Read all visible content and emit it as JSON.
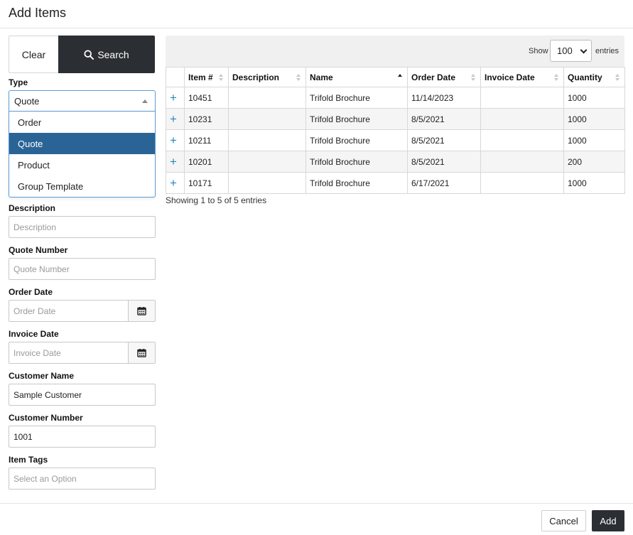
{
  "modal": {
    "title": "Add Items"
  },
  "search_panel": {
    "clear_label": "Clear",
    "search_label": "Search",
    "type": {
      "label": "Type",
      "value": "Quote",
      "options": [
        "Order",
        "Quote",
        "Product",
        "Group Template"
      ],
      "selected_index": 1
    },
    "description": {
      "label": "Description",
      "placeholder": "Description",
      "value": ""
    },
    "quote_number": {
      "label": "Quote Number",
      "placeholder": "Quote Number",
      "value": ""
    },
    "order_date": {
      "label": "Order Date",
      "placeholder": "Order Date"
    },
    "invoice_date": {
      "label": "Invoice Date",
      "placeholder": "Invoice Date"
    },
    "customer_name": {
      "label": "Customer Name",
      "value": "Sample Customer"
    },
    "customer_number": {
      "label": "Customer Number",
      "value": "1001"
    },
    "item_tags": {
      "label": "Item Tags",
      "placeholder": "Select an Option"
    }
  },
  "results": {
    "show_label": "Show",
    "page_size": "100",
    "entries_label": "entries",
    "columns": [
      "",
      "Item #",
      "Description",
      "Name",
      "Order Date",
      "Invoice Date",
      "Quantity"
    ],
    "rows": [
      {
        "item": "10451",
        "description": "",
        "name": "Trifold Brochure",
        "order_date": "11/14/2023",
        "invoice_date": "",
        "quantity": "1000"
      },
      {
        "item": "10231",
        "description": "",
        "name": "Trifold Brochure",
        "order_date": "8/5/2021",
        "invoice_date": "",
        "quantity": "1000"
      },
      {
        "item": "10211",
        "description": "",
        "name": "Trifold Brochure",
        "order_date": "8/5/2021",
        "invoice_date": "",
        "quantity": "1000"
      },
      {
        "item": "10201",
        "description": "",
        "name": "Trifold Brochure",
        "order_date": "8/5/2021",
        "invoice_date": "",
        "quantity": "200"
      },
      {
        "item": "10171",
        "description": "",
        "name": "Trifold Brochure",
        "order_date": "6/17/2021",
        "invoice_date": "",
        "quantity": "1000"
      }
    ],
    "add_row_icon": "+",
    "info": "Showing 1 to 5 of 5 entries"
  },
  "footer": {
    "cancel_label": "Cancel",
    "add_label": "Add"
  },
  "colors": {
    "dark_button": "#2b2f33",
    "selected_option": "#2a6496",
    "plus_icon": "#2a86c2",
    "focus_border": "#5b9bd5"
  }
}
